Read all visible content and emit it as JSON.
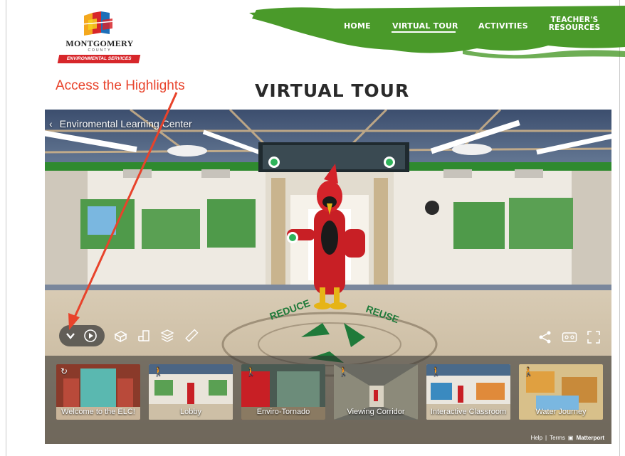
{
  "logo": {
    "name": "MONTGOMERY",
    "sub": "COUNTY",
    "banner": "ENVIRONMENTAL SERVICES",
    "colors": [
      "#f4a81d",
      "#d7262a",
      "#1d6fb8",
      "#f4d21d"
    ]
  },
  "nav": {
    "home": "HOME",
    "virtual_tour": "VIRTUAL TOUR",
    "activities": "ACTIVITIES",
    "teachers_resources": "TEACHER'S RESOURCES",
    "brush_color": "#4a9a2a"
  },
  "annotation": {
    "text": "Access the Highlights",
    "color": "#e8432b"
  },
  "page_title": "VIRTUAL TOUR",
  "viewer": {
    "title": "Enviromental Learning Center",
    "controls": {
      "expand_icon": "chevron-down-icon",
      "play_icon": "play-circle-icon",
      "dollhouse_icon": "dollhouse-icon",
      "floorplan_icon": "floorplan-icon",
      "floors_icon": "layers-icon",
      "measure_icon": "ruler-icon",
      "share_icon": "share-icon",
      "vr_icon": "vr-headset-icon",
      "fullscreen_icon": "fullscreen-icon"
    },
    "highlights": [
      {
        "label": "Welcome to the ELC!"
      },
      {
        "label": "Lobby"
      },
      {
        "label": "Enviro-Tornado"
      },
      {
        "label": "Viewing Corridor"
      },
      {
        "label": "Interactive Classroom"
      },
      {
        "label": "Water Journey"
      }
    ],
    "footer": {
      "help": "Help",
      "separator": "|",
      "terms": "Terms",
      "brand": "Matterport"
    }
  }
}
